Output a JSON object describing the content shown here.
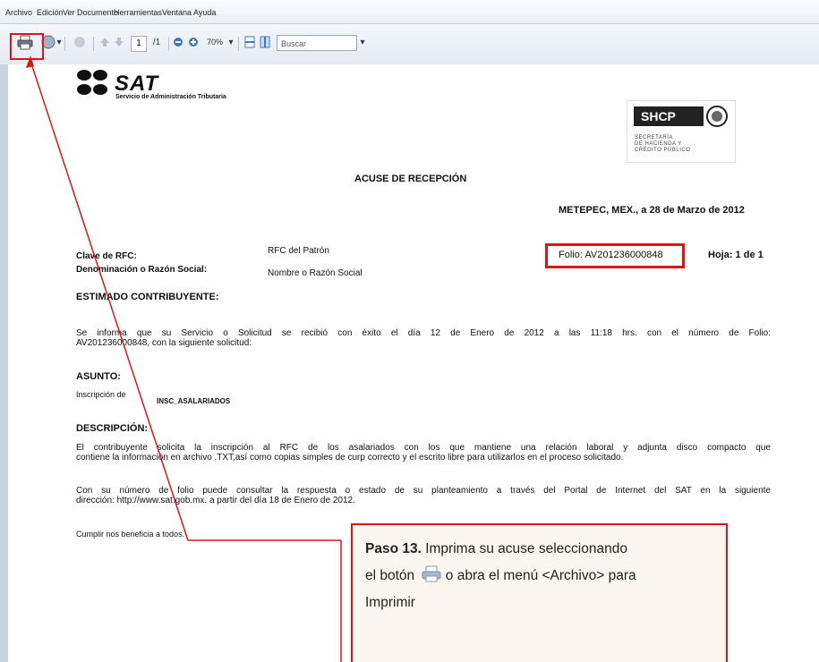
{
  "menu": [
    "Archivo",
    "Edición",
    "Ver",
    "Documento",
    "Herramientas",
    "Ventana",
    "Ayuda"
  ],
  "toolbar": {
    "page_current": "1",
    "page_total": "/1",
    "zoom": "70%",
    "search_placeholder": "Buscar"
  },
  "document": {
    "logo_name": "SAT",
    "logo_subtitle": "Servicio de Administración Tributaria",
    "shcp_logo": "SHCP",
    "shcp_subtitle_1": "SECRETARÍA",
    "shcp_subtitle_2": "DE HACIENDA Y",
    "shcp_subtitle_3": "CRÉDITO PÚBLICO",
    "title": "ACUSE DE RECEPCIÓN",
    "place_date": "METEPEC, MEX., a 28 de Marzo de 2012",
    "rfc_label": "Clave de RFC:",
    "rfc_value": "RFC del Patrón",
    "name_label": "Denominación o Razón Social:",
    "name_value": "Nombre o Razón Social",
    "folio": "Folio: AV201236000848",
    "page_of": "Hoja: 1 de 1",
    "greeting": "ESTIMADO CONTRIBUYENTE:",
    "para1_line1": "Se informa que su Servicio o Solicitud se recibió con éxito el día 12 de Enero de 2012 a las 11:18 hrs. con el número de Folio:",
    "para1_line2": "AV201236000848, con la siguiente solicitud:",
    "subject_label": "ASUNTO:",
    "subject_prefix": "Inscripción de",
    "subject_value": "INSC_ASALARIADOS",
    "desc_label": "DESCRIPCIÓN:",
    "desc_line1": "El contribuyente solicita la inscripción al RFC de los asalariados con los que mantiene una relación  laboral y adjunta disco compacto que",
    "desc_line2": "contiene la información en archivo .TXT,así como copias simples de curp correcto y el escrito libre para utilizarlos en el proceso solicitado.",
    "consult_line1": "Con su número de folio puede consultar la respuesta o estado de su planteamiento a través del Portal de Internet del SAT en la siguiente",
    "consult_line2": "dirección: http://www.sat.gob.mx. a partir del día 18 de Enero de 2012.",
    "closing": "Cumplir nos beneficia a todos."
  },
  "callout": {
    "step": "Paso 13.",
    "text_a": " Imprima su acuse seleccionando",
    "text_b": "el botón",
    "text_c": " o abra el menú <Archivo> para",
    "text_d": "Imprimir"
  },
  "colors": {
    "highlight": "#e0131b",
    "callout_bg": "#fbf6f0"
  }
}
